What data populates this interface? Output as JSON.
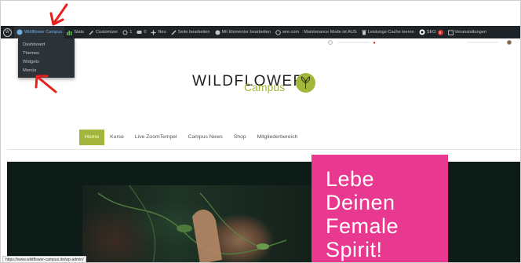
{
  "adminbar": {
    "site_name": "Wildflower Campus",
    "items": {
      "stats": "Stats",
      "customizer": "Customizer",
      "updates": "1",
      "comments": "0",
      "new": "Neu",
      "edit_page": "Seite bearbeiten",
      "elementor": "Mit Elementor bearbeiten",
      "wre": "wre.com",
      "maintenance": "Maintenance Mode ist AUS",
      "cache": "Leistungs-Cache leeren",
      "seo": "SEO",
      "seo_badge": "6",
      "events": "Veranstaltungen"
    },
    "dropdown": [
      "Dashboard",
      "Themes",
      "Widgets",
      "Menüs"
    ]
  },
  "logo": {
    "wordmark": "WILDFLOWER",
    "sub": "Campus"
  },
  "nav": [
    "Home",
    "Kurse",
    "Live ZoomTempel",
    "Campus News",
    "Shop",
    "Mitgliederbereich"
  ],
  "hero": {
    "lines": [
      "Lebe",
      "Deinen",
      "Female",
      "Spirit!"
    ]
  },
  "status_url": "https://www.wildflower-campus.de/wp-admin/",
  "colors": {
    "accent_green": "#a3b53a",
    "pink": "#e8388f",
    "adminbar": "#1d2327",
    "annotation_red": "#e8201b"
  }
}
